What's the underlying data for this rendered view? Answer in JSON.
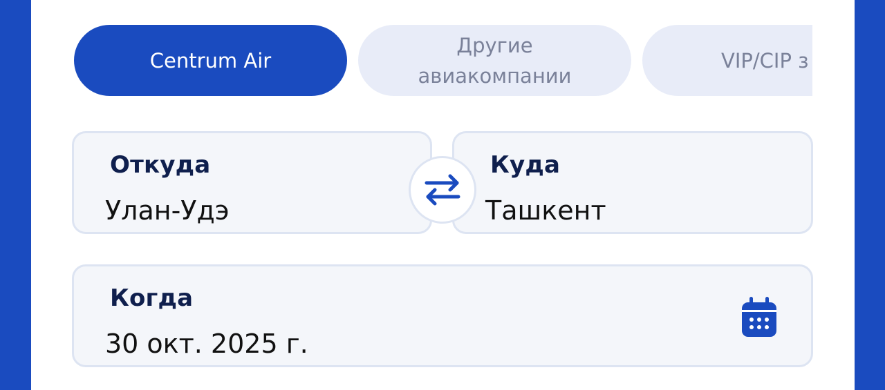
{
  "tabs": [
    {
      "label": "Centrum Air",
      "active": true
    },
    {
      "label": "Другие авиакомпании",
      "active": false
    },
    {
      "label": "VIP/CIP з",
      "active": false
    }
  ],
  "from": {
    "label": "Откуда",
    "value": "Улан-Удэ"
  },
  "to": {
    "label": "Куда",
    "value": "Ташкент"
  },
  "when": {
    "label": "Когда",
    "value": "30 окт. 2025 г."
  },
  "icons": {
    "swap": "swap-arrows-icon",
    "calendar": "calendar-icon"
  },
  "colors": {
    "brand": "#1a4bbf",
    "tab_inactive_bg": "#e8ecf8",
    "tab_inactive_text": "#7a8199",
    "field_bg": "#f4f6fa",
    "field_border": "#dde4f2",
    "label_text": "#0f1f4d"
  }
}
